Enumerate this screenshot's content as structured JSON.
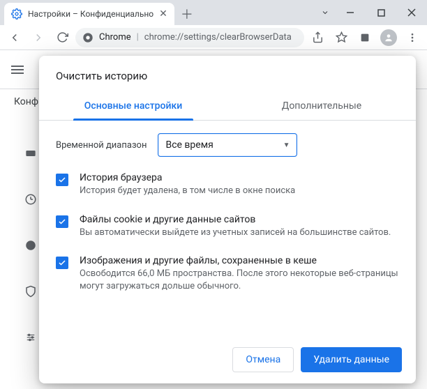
{
  "window": {
    "tab_title": "Настройки – Конфиденциально",
    "omnibox_prefix": "Chrome",
    "omnibox_path": "chrome://settings/clearBrowserData"
  },
  "settings_bg": {
    "breadcrumb": "Конф"
  },
  "dialog": {
    "title": "Очистить историю",
    "tabs": {
      "basic": "Основные настройки",
      "advanced": "Дополнительные"
    },
    "range_label": "Временной диапазон",
    "range_value": "Все время",
    "items": [
      {
        "title": "История браузера",
        "desc": "История будет удалена, в том числе в окне поиска"
      },
      {
        "title": "Файлы cookie и другие данные сайтов",
        "desc": "Вы автоматически выйдете из учетных записей на большинстве сайтов."
      },
      {
        "title": "Изображения и другие файлы, сохраненные в кеше",
        "desc": "Освободится 66,0 МБ пространства. После этого некоторые веб-страницы могут загружаться дольше обычного."
      }
    ],
    "actions": {
      "cancel": "Отмена",
      "confirm": "Удалить данные"
    }
  }
}
